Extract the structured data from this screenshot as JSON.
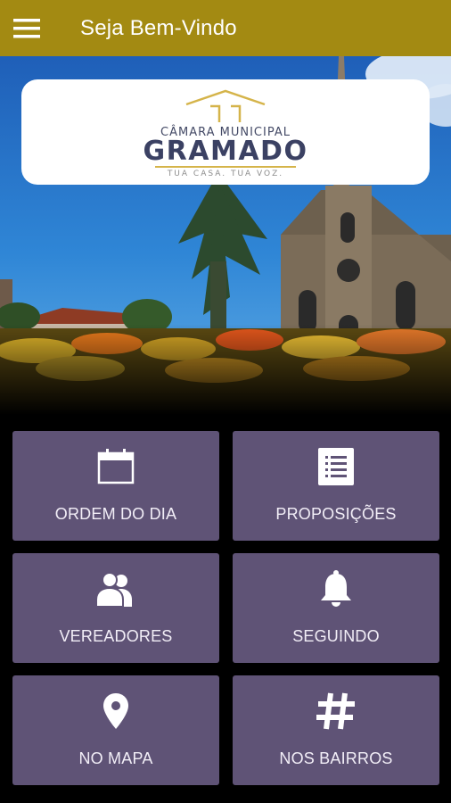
{
  "appbar": {
    "title": "Seja Bem-Vindo",
    "menu_icon": "hamburger-menu-icon"
  },
  "logo": {
    "line1": "CÂMARA MUNICIPAL",
    "line2": "GRAMADO",
    "line3": "TUA CASA. TUA VOZ."
  },
  "tiles": [
    {
      "label": "ORDEM DO DIA",
      "icon": "calendar-icon"
    },
    {
      "label": "PROPOSIÇÕES",
      "icon": "document-list-icon"
    },
    {
      "label": "VEREADORES",
      "icon": "users-icon"
    },
    {
      "label": "SEGUINDO",
      "icon": "bell-icon"
    },
    {
      "label": "NO MAPA",
      "icon": "map-pin-icon"
    },
    {
      "label": "NOS BAIRROS",
      "icon": "hashtag-icon"
    }
  ],
  "colors": {
    "appbar": "#a38a12",
    "tile": "#5f5376",
    "background": "#000000",
    "logo_text": "#3b4163",
    "logo_accent": "#d5b44a"
  }
}
